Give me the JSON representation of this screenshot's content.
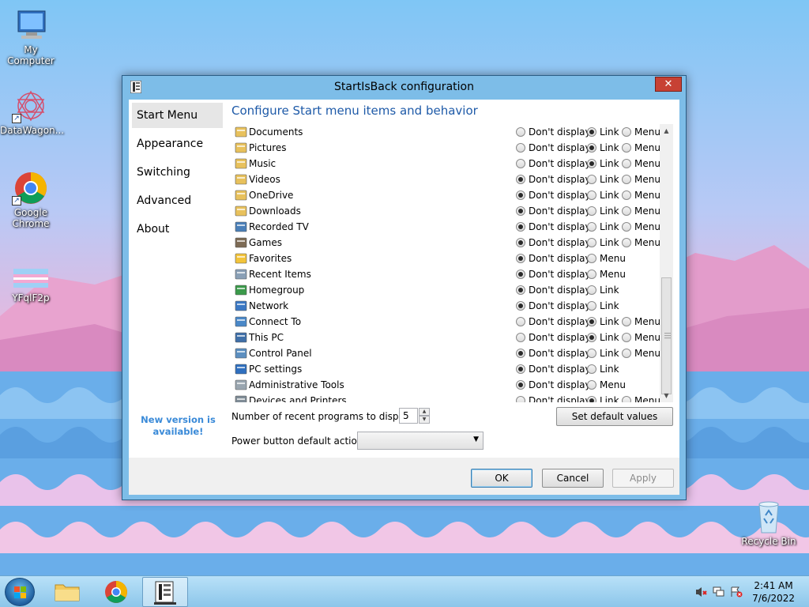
{
  "desktop": {
    "icons": [
      {
        "label": "My Computer"
      },
      {
        "label": "DataWagon..."
      },
      {
        "label": "Google Chrome"
      },
      {
        "label": "YFqlF2p"
      },
      {
        "label": "Recycle Bin"
      }
    ]
  },
  "window": {
    "title": "StartIsBack configuration",
    "close_label": "✕",
    "nav": [
      "Start Menu",
      "Appearance",
      "Switching",
      "Advanced",
      "About"
    ],
    "new_version": "New version is available!",
    "heading": "Configure Start menu items and behavior",
    "option_labels": {
      "dont": "Don't display",
      "link": "Link",
      "menu": "Menu"
    },
    "items": [
      {
        "name": "Documents",
        "icon": "folder-documents-icon",
        "options": [
          "dont",
          "link",
          "menu"
        ],
        "selected": "link"
      },
      {
        "name": "Pictures",
        "icon": "folder-pictures-icon",
        "options": [
          "dont",
          "link",
          "menu"
        ],
        "selected": "link"
      },
      {
        "name": "Music",
        "icon": "folder-music-icon",
        "options": [
          "dont",
          "link",
          "menu"
        ],
        "selected": "link"
      },
      {
        "name": "Videos",
        "icon": "folder-videos-icon",
        "options": [
          "dont",
          "link",
          "menu"
        ],
        "selected": "dont"
      },
      {
        "name": "OneDrive",
        "icon": "folder-onedrive-icon",
        "options": [
          "dont",
          "link",
          "menu"
        ],
        "selected": "dont"
      },
      {
        "name": "Downloads",
        "icon": "folder-downloads-icon",
        "options": [
          "dont",
          "link",
          "menu"
        ],
        "selected": "dont"
      },
      {
        "name": "Recorded TV",
        "icon": "recorded-tv-icon",
        "options": [
          "dont",
          "link",
          "menu"
        ],
        "selected": "dont"
      },
      {
        "name": "Games",
        "icon": "games-icon",
        "options": [
          "dont",
          "link",
          "menu"
        ],
        "selected": "dont"
      },
      {
        "name": "Favorites",
        "icon": "favorites-star-icon",
        "options": [
          "dont",
          "menu"
        ],
        "selected": "dont"
      },
      {
        "name": "Recent Items",
        "icon": "recent-items-icon",
        "options": [
          "dont",
          "menu"
        ],
        "selected": "dont"
      },
      {
        "name": "Homegroup",
        "icon": "homegroup-icon",
        "options": [
          "dont",
          "link"
        ],
        "selected": "dont"
      },
      {
        "name": "Network",
        "icon": "network-icon",
        "options": [
          "dont",
          "link"
        ],
        "selected": "dont"
      },
      {
        "name": "Connect To",
        "icon": "connect-to-icon",
        "options": [
          "dont",
          "link",
          "menu"
        ],
        "selected": "link"
      },
      {
        "name": "This PC",
        "icon": "this-pc-icon",
        "options": [
          "dont",
          "link",
          "menu"
        ],
        "selected": "link"
      },
      {
        "name": "Control Panel",
        "icon": "control-panel-icon",
        "options": [
          "dont",
          "link",
          "menu"
        ],
        "selected": "dont"
      },
      {
        "name": "PC settings",
        "icon": "pc-settings-gear-icon",
        "options": [
          "dont",
          "link"
        ],
        "selected": "dont"
      },
      {
        "name": "Administrative Tools",
        "icon": "administrative-tools-icon",
        "options": [
          "dont",
          "menu"
        ],
        "selected": "dont"
      },
      {
        "name": "Devices and Printers",
        "icon": "devices-printers-icon",
        "options": [
          "dont",
          "link",
          "menu"
        ],
        "selected": "link"
      }
    ],
    "recent_label": "Number of recent programs to display:",
    "recent_value": "5",
    "default_button": "Set default values",
    "power_label": "Power button default action:",
    "power_value": "",
    "ok": "OK",
    "cancel": "Cancel",
    "apply": "Apply"
  },
  "taskbar": {
    "clock_time": "2:41 AM",
    "clock_date": "7/6/2022"
  }
}
